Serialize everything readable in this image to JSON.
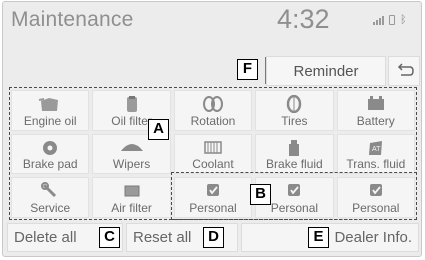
{
  "header": {
    "title": "Maintenance",
    "clock": "4:32"
  },
  "status_icons": [
    "signal-icon",
    "phone-battery-icon",
    "bluetooth-icon"
  ],
  "toolbar": {
    "reminder_label": "Reminder"
  },
  "items": [
    {
      "label": "Engine oil",
      "icon": "oil-can-icon"
    },
    {
      "label": "Oil filter",
      "icon": "oil-filter-icon"
    },
    {
      "label": "Rotation",
      "icon": "tire-rotation-icon"
    },
    {
      "label": "Tires",
      "icon": "tire-icon"
    },
    {
      "label": "Battery",
      "icon": "battery-icon"
    },
    {
      "label": "Brake pad",
      "icon": "brake-disc-icon"
    },
    {
      "label": "Wipers",
      "icon": "wiper-icon"
    },
    {
      "label": "Coolant",
      "icon": "radiator-icon"
    },
    {
      "label": "Brake fluid",
      "icon": "brake-fluid-icon"
    },
    {
      "label": "Trans. fluid",
      "icon": "transmission-fluid-icon"
    },
    {
      "label": "Service",
      "icon": "wrench-icon"
    },
    {
      "label": "Air filter",
      "icon": "air-filter-icon"
    },
    {
      "label": "Personal",
      "icon": "personal-checkbox-icon"
    },
    {
      "label": "Personal",
      "icon": "personal-checkbox-icon"
    },
    {
      "label": "Personal",
      "icon": "personal-checkbox-icon"
    }
  ],
  "footer": {
    "delete_all": "Delete all",
    "reset_all": "Reset all",
    "dealer_info": "Dealer Info."
  },
  "callouts": {
    "a": "A",
    "b": "B",
    "c": "C",
    "d": "D",
    "e": "E",
    "f": "F"
  },
  "colors": {
    "background": "#ececec",
    "button": "#f5f5f5",
    "text": "#6b6b6b"
  }
}
